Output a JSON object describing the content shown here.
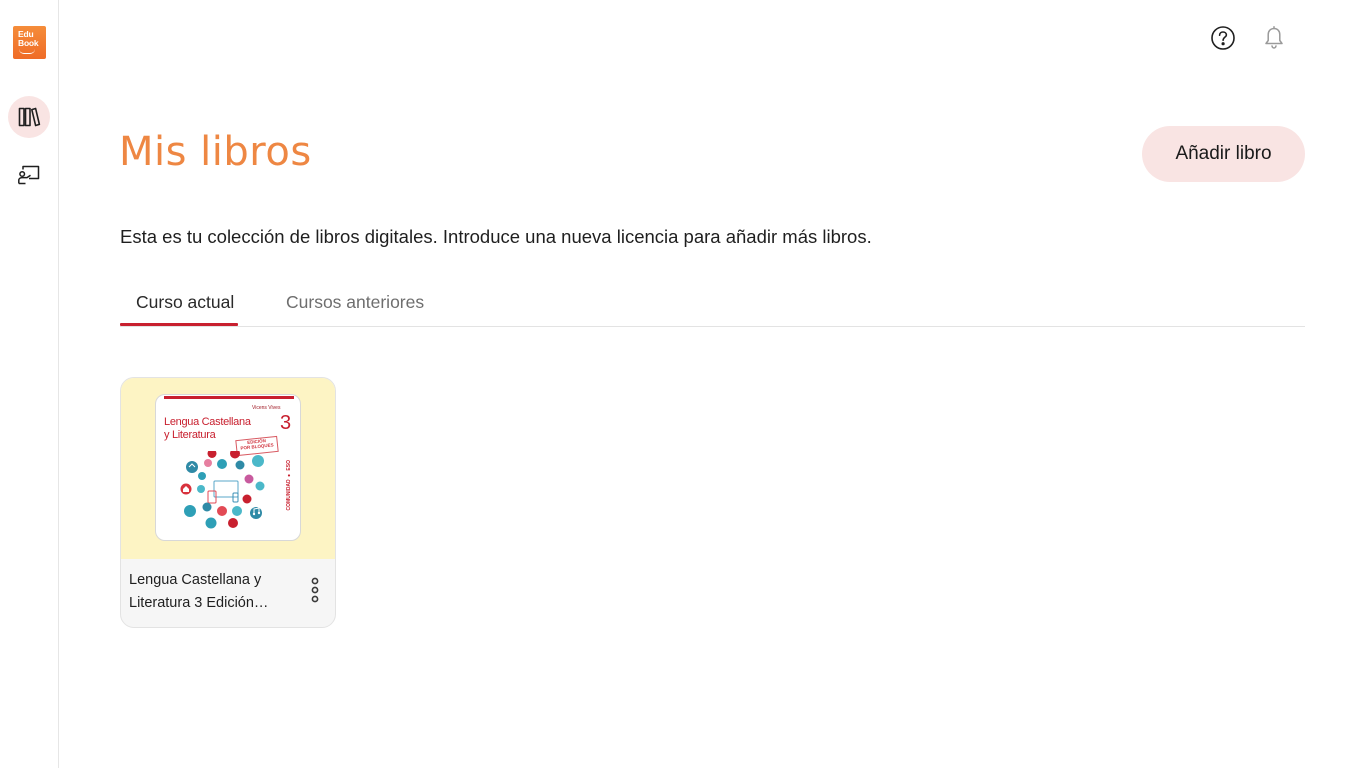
{
  "app": {
    "logo_line1": "Edu",
    "logo_line2": "Book",
    "brand_color": "#ef6c27",
    "accent_color": "#c8202f",
    "title_color": "#ee8743"
  },
  "sidebar": {
    "items": [
      {
        "icon": "library-icon",
        "active": true
      },
      {
        "icon": "classroom-icon",
        "active": false
      }
    ]
  },
  "header": {
    "icons": [
      "help-icon",
      "bell-icon"
    ]
  },
  "main": {
    "title": "Mis libros",
    "add_button_label": "Añadir libro",
    "description": "Esta es tu colección de libros digitales. Introduce una nueva licencia para añadir más libros.",
    "tabs": [
      {
        "label": "Curso actual",
        "selected": true
      },
      {
        "label": "Cursos anteriores",
        "selected": false
      }
    ],
    "books": [
      {
        "title": "Lengua Castellana y Literatura 3 Edición…",
        "cover": {
          "publisher": "Vicens Vives",
          "title_line1": "Lengua Castellana",
          "title_line2": "y Literatura",
          "grade": "3",
          "stamp_line1": "EDICIÓN",
          "stamp_line2": "POR BLOQUES",
          "side_text": "COMUNIDAD ● ESO",
          "background": "#fdf4c4"
        }
      }
    ]
  }
}
